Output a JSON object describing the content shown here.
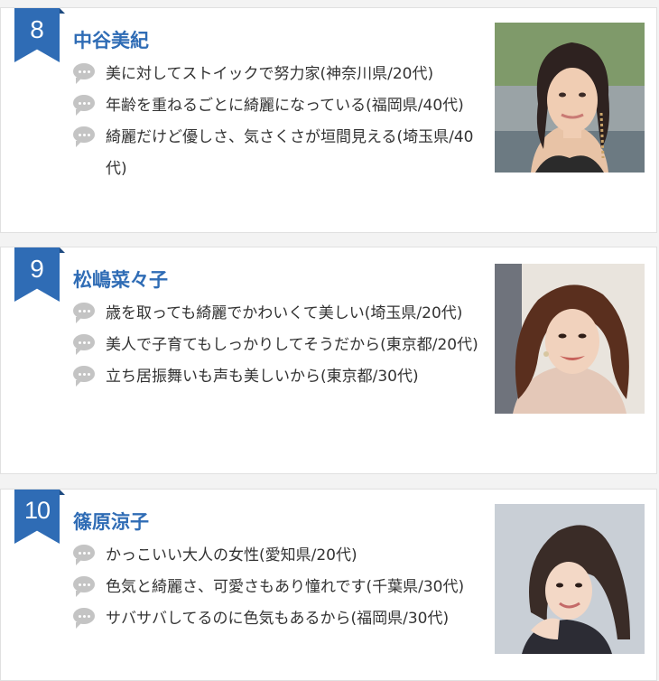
{
  "entries": [
    {
      "rank": "8",
      "name": "中谷美紀",
      "comments": [
        "美に対してストイックで努力家(神奈川県/20代)",
        "年齢を重ねるごとに綺麗になっている(福岡県/40代)",
        "綺麗だけど優しさ、気さくさが垣間見える(埼玉県/40代)"
      ]
    },
    {
      "rank": "9",
      "name": "松嶋菜々子",
      "comments": [
        "歳を取っても綺麗でかわいくて美しい(埼玉県/20代)",
        "美人で子育てもしっかりしてそうだから(東京都/20代)",
        "立ち居振舞いも声も美しいから(東京都/30代)"
      ]
    },
    {
      "rank": "10",
      "name": "篠原涼子",
      "comments": [
        "かっこいい大人の女性(愛知県/20代)",
        "色気と綺麗さ、可愛さもあり憧れです(千葉県/30代)",
        "サバサバしてるのに色気もあるから(福岡県/30代)"
      ]
    }
  ],
  "colors": {
    "accent": "#2f6cb5",
    "bubble": "#c4c4c4",
    "text": "#333333"
  },
  "icons": {
    "comment": "speech-bubble-icon",
    "rank": "ribbon-badge-icon"
  }
}
